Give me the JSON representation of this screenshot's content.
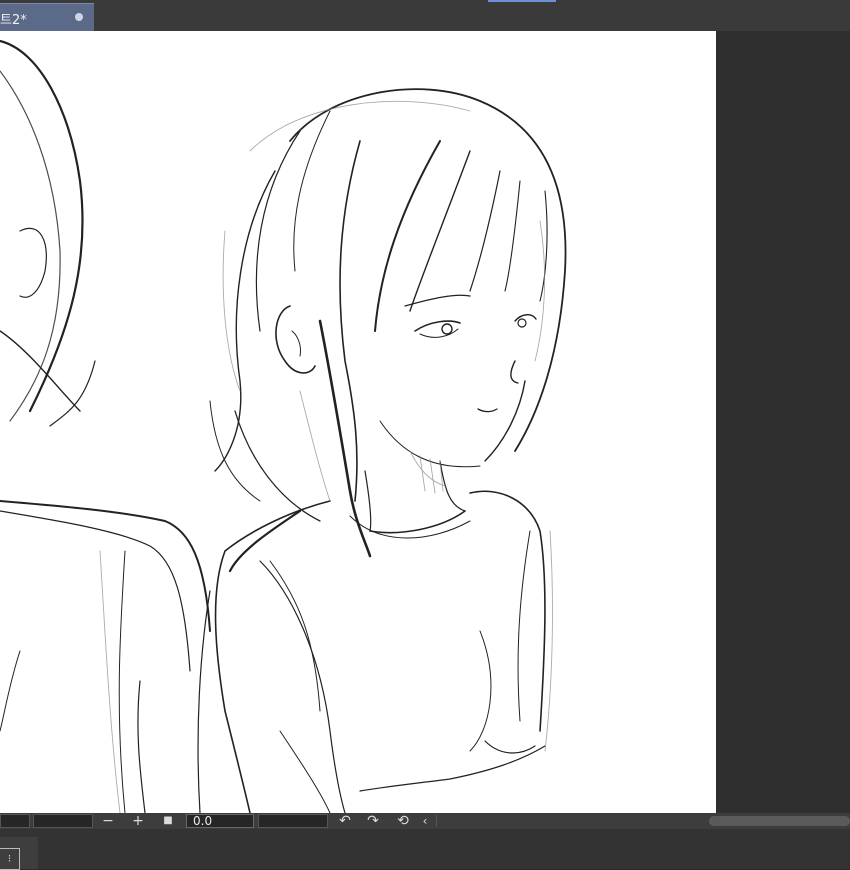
{
  "tab": {
    "title": "트2*"
  },
  "toolbar": {
    "zoom_out_label": "−",
    "zoom_in_label": "+",
    "fit_label": "■",
    "rotation_value": "0.0",
    "rotate_left_label": "↶",
    "rotate_right_label": "↷",
    "reset_rotation_label": "⟲",
    "collapse_label": "‹"
  },
  "status": {
    "icon_label": "⁝"
  },
  "colors": {
    "tab_active": "#5a6a88",
    "canvas_bg": "#ffffff",
    "workspace": "#2f2f2f",
    "accent": "#6f8fd6"
  }
}
